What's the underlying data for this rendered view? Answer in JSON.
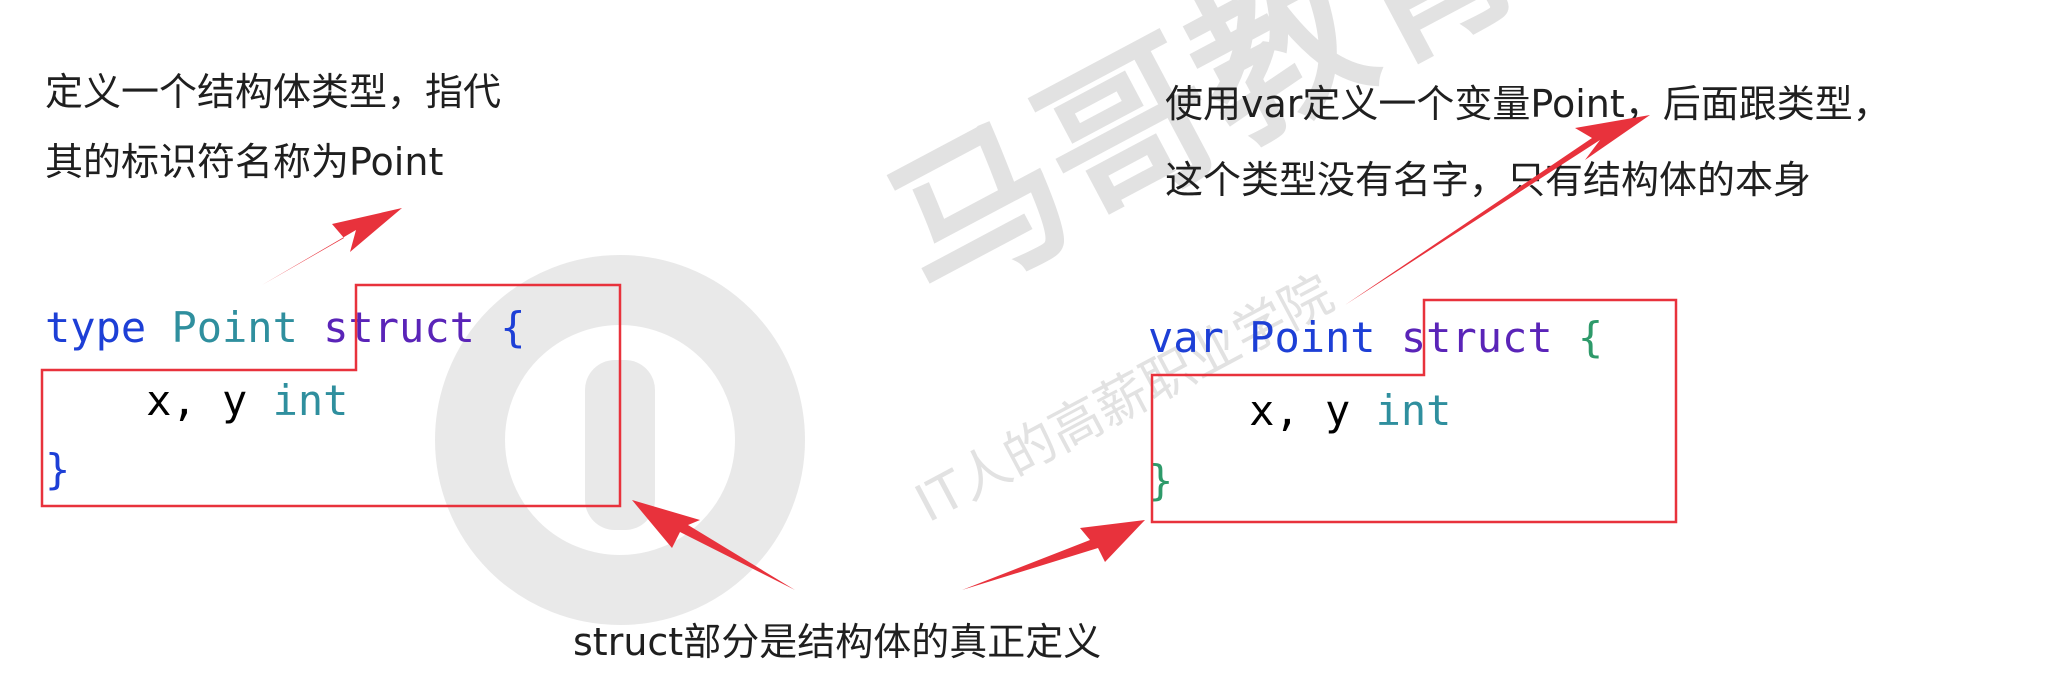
{
  "notes": {
    "left_line1": "定义一个结构体类型，指代",
    "left_line2": "其的标识符名称为Point",
    "right_line1": "使用var定义一个变量Point，后面跟类型，",
    "right_line2": "这个类型没有名字，只有结构体的本身",
    "bottom": "struct部分是结构体的真正定义"
  },
  "left_code": {
    "kw_type": "type",
    "name": "Point",
    "kw_struct": "struct",
    "open_brace": "{",
    "fields": "x, y",
    "field_type": "int",
    "close_brace": "}"
  },
  "right_code": {
    "kw_var": "var",
    "name": "Point",
    "kw_struct": "struct",
    "open_brace": "{",
    "fields": "x, y",
    "field_type": "int",
    "close_brace": "}"
  },
  "watermark": {
    "brand": "马哥教育",
    "slogan": "IT人的高薪职业学院"
  },
  "colors": {
    "box": "#e8323c",
    "arrow": "#e8323c"
  }
}
